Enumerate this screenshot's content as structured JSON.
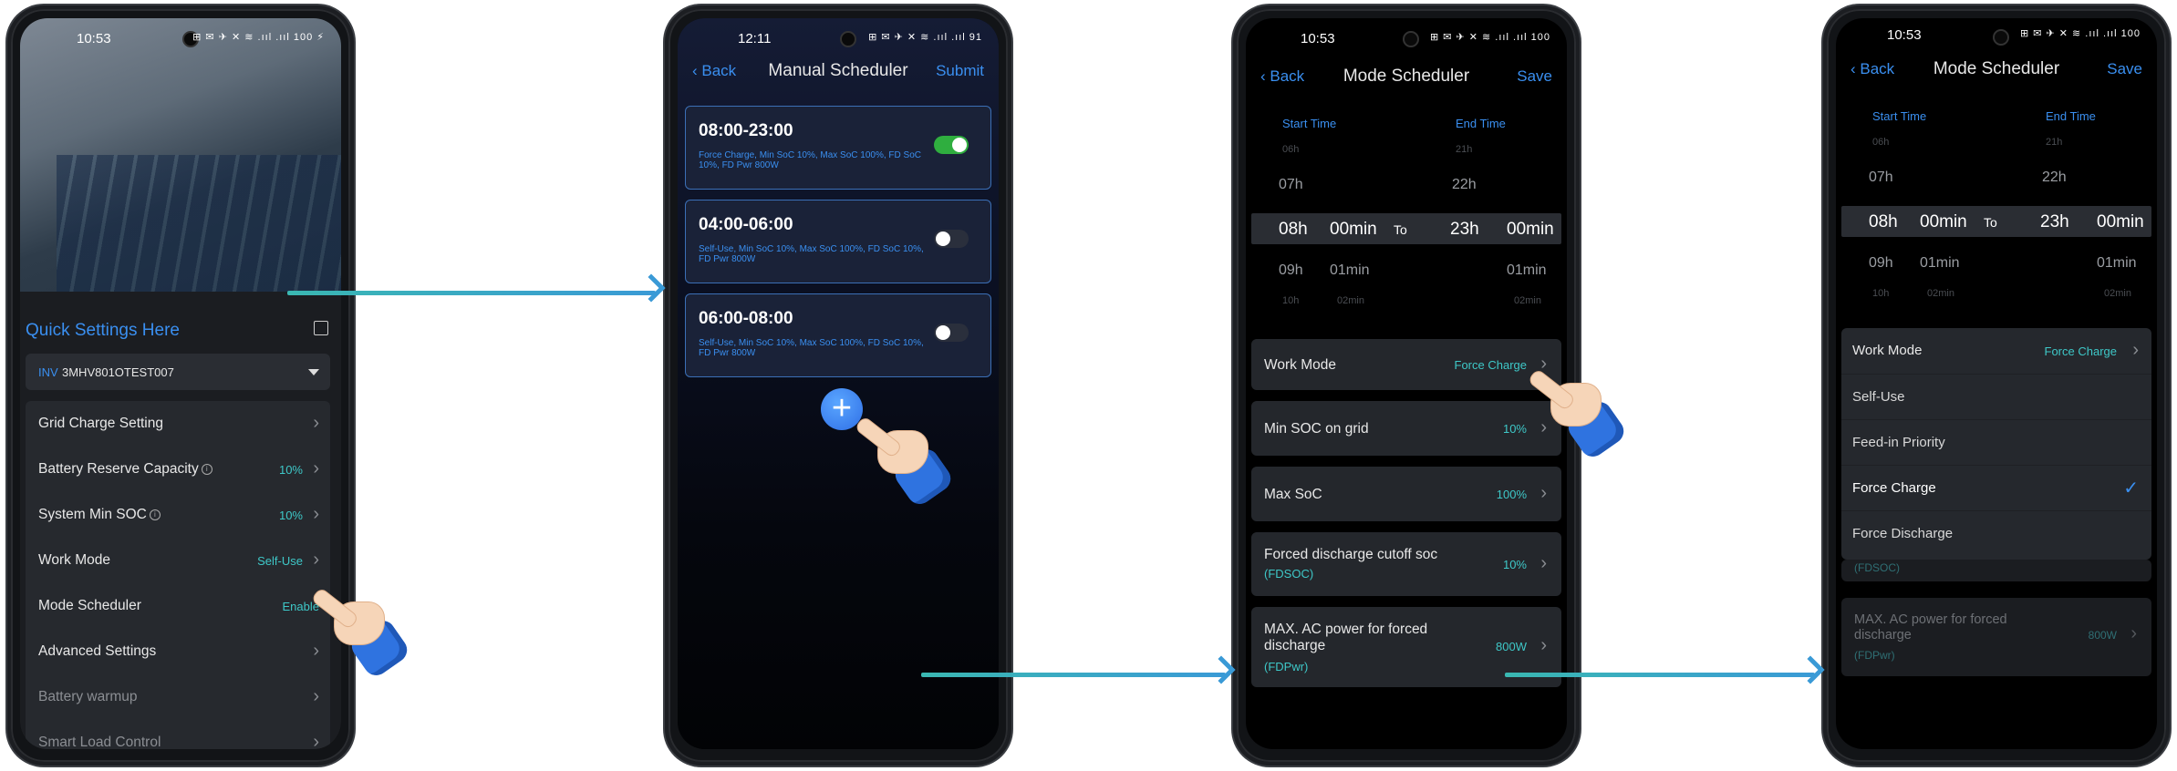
{
  "phone1": {
    "status_time": "10:53",
    "status_icons": "⊞ ✉ ✈ ✕ ≋ .ııl .ııl 100 ⚡",
    "quick_title": "Quick Settings Here",
    "inv_label": "INV",
    "inv_serial": "3MHV801OTEST007",
    "rows": [
      {
        "label": "Grid Charge Setting",
        "value": ""
      },
      {
        "label": "Battery Reserve Capacity",
        "value": "10%"
      },
      {
        "label": "System Min SOC",
        "value": "10%"
      },
      {
        "label": "Work Mode",
        "value": "Self-Use"
      },
      {
        "label": "Mode Scheduler",
        "value": "Enable"
      },
      {
        "label": "Advanced Settings",
        "value": ""
      },
      {
        "label": "Battery warmup",
        "value": ""
      },
      {
        "label": "Smart Load Control",
        "value": ""
      }
    ]
  },
  "phone2": {
    "status_time": "12:11",
    "status_icons": "⊞ ✉ ✈ ✕ ≋ .ııl .ııl 91",
    "back": "Back",
    "title": "Manual Scheduler",
    "action": "Submit",
    "schedules": [
      {
        "time": "08:00-23:00",
        "desc": "Force Charge, Min SoC 10%, Max SoC 100%, FD SoC 10%, FD Pwr 800W",
        "enabled": true
      },
      {
        "time": "04:00-06:00",
        "desc": "Self-Use, Min SoC 10%, Max SoC 100%, FD SoC 10%, FD Pwr 800W",
        "enabled": false
      },
      {
        "time": "06:00-08:00",
        "desc": "Self-Use, Min SoC 10%, Max SoC 100%, FD SoC 10%, FD Pwr 800W",
        "enabled": false
      }
    ],
    "add_symbol": "+"
  },
  "phone3": {
    "status_time": "10:53",
    "status_icons": "⊞ ✉ ✈ ✕ ≋ .ııl .ııl 100",
    "back": "Back",
    "title": "Mode Scheduler",
    "action": "Save",
    "start_head": "Start Time",
    "end_head": "End Time",
    "picker": {
      "h_prev2": "06h",
      "h_prev1": "07h",
      "h_sel": "08h",
      "h_next1": "09h",
      "h_next2": "10h",
      "m_prev2": "",
      "m_prev1": "",
      "m_sel": "00min",
      "m_next1": "01min",
      "m_next2": "02min",
      "to": "To",
      "eh_prev2": "21h",
      "eh_prev1": "22h",
      "eh_sel": "23h",
      "eh_next1": "",
      "eh_next2": "",
      "em_sel": "00min",
      "em_next1": "01min",
      "em_next2": "02min"
    },
    "work_mode_label": "Work Mode",
    "work_mode_value": "Force Charge",
    "min_soc_label": "Min SOC on grid",
    "min_soc_value": "10%",
    "max_soc_label": "Max SoC",
    "max_soc_value": "100%",
    "fdsoc_label": "Forced discharge cutoff soc",
    "fdsoc_sub": "(FDSOC)",
    "fdsoc_value": "10%",
    "fdpwr_label": "MAX. AC power for forced discharge",
    "fdpwr_sub": "(FDPwr)",
    "fdpwr_value": "800W"
  },
  "phone4": {
    "status_time": "10:53",
    "status_icons": "⊞ ✉ ✈ ✕ ≋ .ııl .ııl 100",
    "back": "Back",
    "title": "Mode Scheduler",
    "action": "Save",
    "start_head": "Start Time",
    "end_head": "End Time",
    "work_mode_label": "Work Mode",
    "work_mode_value": "Force Charge",
    "options": [
      "Self-Use",
      "Feed-in Priority",
      "Force Charge",
      "Force Discharge"
    ],
    "selected_option": "Force Charge",
    "fdsoc_sub": "(FDSOC)",
    "fdpwr_label": "MAX. AC power for forced discharge",
    "fdpwr_sub": "(FDPwr)",
    "fdpwr_value": "800W"
  },
  "colors": {
    "accent": "#3a8ff0",
    "teal_value": "#3ec8c8",
    "arrow": "#3ab0c8",
    "toggle_on": "#2fae3f",
    "cuff": "#2f73e0"
  }
}
